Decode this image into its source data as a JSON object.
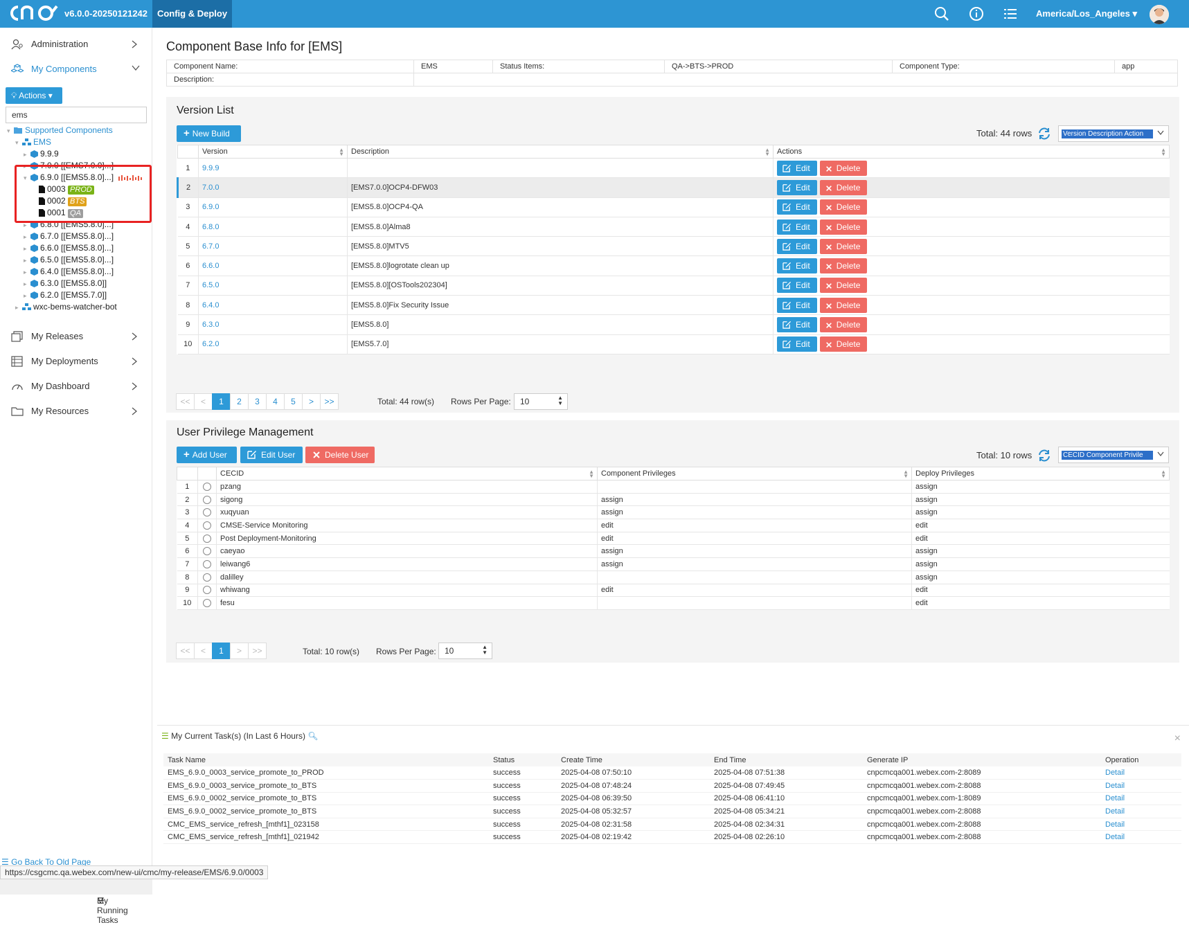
{
  "app": {
    "version": "v6.0.0-20250121242",
    "nav_active": "Config & Deploy",
    "timezone": "America/Los_Angeles"
  },
  "sidebar": {
    "items": [
      {
        "label": "Administration",
        "icon": "admin-icon"
      },
      {
        "label": "My Components",
        "icon": "components-icon"
      },
      {
        "label": "My Releases",
        "icon": "releases-icon"
      },
      {
        "label": "My Deployments",
        "icon": "deployments-icon"
      },
      {
        "label": "My Dashboard",
        "icon": "dashboard-icon"
      },
      {
        "label": "My Resources",
        "icon": "folder-icon"
      }
    ],
    "actions_label": "Actions",
    "search_value": "ems",
    "tree": {
      "root": "Supported Components",
      "ems": "EMS",
      "versions": [
        {
          "label": "9.9.9"
        },
        {
          "label": "7.0.0 [[EMS7.0.0]...]"
        },
        {
          "label": "6.9.0 [[EMS5.8.0]...]"
        },
        {
          "label": "6.8.0 [[EMS5.8.0]...]"
        },
        {
          "label": "6.7.0 [[EMS5.8.0]...]"
        },
        {
          "label": "6.6.0 [[EMS5.8.0]...]"
        },
        {
          "label": "6.5.0 [[EMS5.8.0]...]"
        },
        {
          "label": "6.4.0 [[EMS5.8.0]...]"
        },
        {
          "label": "6.3.0 [[EMS5.8.0]]"
        },
        {
          "label": "6.2.0 [[EMS5.7.0]]"
        }
      ],
      "builds": [
        {
          "id": "0003",
          "badge": "PROD",
          "color": "#7ab317"
        },
        {
          "id": "0002",
          "badge": "BTS",
          "color": "#e0a21a"
        },
        {
          "id": "0001",
          "badge": "QA",
          "color": "#9e9e9e"
        }
      ],
      "other": "wxc-bems-watcher-bot"
    },
    "go_back": "Go Back To Old Page",
    "running_tasks": "My Running Tasks"
  },
  "status_url": "https://csgcmc.qa.webex.com/new-ui/cmc/my-release/EMS/6.9.0/0003",
  "base_info": {
    "title": "Component Base Info for [EMS]",
    "component_name_label": "Component Name:",
    "component_name": "EMS",
    "status_items_label": "Status Items:",
    "status_items": "QA->BTS->PROD",
    "component_type_label": "Component Type:",
    "component_type": "app",
    "description_label": "Description:",
    "description": ""
  },
  "version_list": {
    "title": "Version List",
    "new_build": "New Build",
    "total": "Total: 44 rows",
    "column_selector": "Version Description Action",
    "headers": [
      "Version",
      "Description",
      "Actions"
    ],
    "edit_label": "Edit",
    "delete_label": "Delete",
    "rows": [
      {
        "n": "1",
        "version": "9.9.9",
        "description": ""
      },
      {
        "n": "2",
        "version": "7.0.0",
        "description": "[EMS7.0.0]OCP4-DFW03"
      },
      {
        "n": "3",
        "version": "6.9.0",
        "description": "[EMS5.8.0]OCP4-QA"
      },
      {
        "n": "4",
        "version": "6.8.0",
        "description": "[EMS5.8.0]Alma8"
      },
      {
        "n": "5",
        "version": "6.7.0",
        "description": "[EMS5.8.0]MTV5"
      },
      {
        "n": "6",
        "version": "6.6.0",
        "description": "[EMS5.8.0]logrotate clean up"
      },
      {
        "n": "7",
        "version": "6.5.0",
        "description": "[EMS5.8.0][OSTools202304]"
      },
      {
        "n": "8",
        "version": "6.4.0",
        "description": "[EMS5.8.0]Fix Security Issue"
      },
      {
        "n": "9",
        "version": "6.3.0",
        "description": "[EMS5.8.0]"
      },
      {
        "n": "10",
        "version": "6.2.0",
        "description": "[EMS5.7.0]"
      }
    ],
    "pager": [
      "<<",
      "<",
      "1",
      "2",
      "3",
      "4",
      "5",
      ">",
      ">>"
    ],
    "pager_total": "Total: 44 row(s)",
    "rows_per_page_label": "Rows Per Page:",
    "rows_per_page": "10"
  },
  "user_priv": {
    "title": "User Privilege Management",
    "add_user": "Add User",
    "edit_user": "Edit User",
    "delete_user": "Delete User",
    "total": "Total: 10 rows",
    "column_selector": "CECID Component Privile",
    "headers": [
      "CECID",
      "Component Privileges",
      "Deploy Privileges"
    ],
    "rows": [
      {
        "n": "1",
        "cecid": "pzang",
        "comp": "",
        "deploy": "assign"
      },
      {
        "n": "2",
        "cecid": "sigong",
        "comp": "assign",
        "deploy": "assign"
      },
      {
        "n": "3",
        "cecid": "xuqyuan",
        "comp": "assign",
        "deploy": "assign"
      },
      {
        "n": "4",
        "cecid": "CMSE-Service Monitoring",
        "comp": "edit",
        "deploy": "edit"
      },
      {
        "n": "5",
        "cecid": "Post Deployment-Monitoring",
        "comp": "edit",
        "deploy": "edit"
      },
      {
        "n": "6",
        "cecid": "caeyao",
        "comp": "assign",
        "deploy": "assign"
      },
      {
        "n": "7",
        "cecid": "leiwang6",
        "comp": "assign",
        "deploy": "assign"
      },
      {
        "n": "8",
        "cecid": "dalilley",
        "comp": "",
        "deploy": "assign"
      },
      {
        "n": "9",
        "cecid": "whiwang",
        "comp": "edit",
        "deploy": "edit"
      },
      {
        "n": "10",
        "cecid": "fesu",
        "comp": "",
        "deploy": "edit"
      }
    ],
    "pager": [
      "<<",
      "<",
      "1",
      ">",
      ">>"
    ],
    "pager_total": "Total: 10 row(s)",
    "rows_per_page_label": "Rows Per Page:",
    "rows_per_page": "10"
  },
  "tasks": {
    "title": "My Current Task(s) (In Last 6 Hours)",
    "close": "×",
    "headers": [
      "Task Name",
      "Status",
      "Create Time",
      "End Time",
      "Generate IP",
      "Operation"
    ],
    "rows": [
      {
        "name": "EMS_6.9.0_0003_service_promote_to_PROD",
        "status": "success",
        "create": "2025-04-08 07:50:10",
        "end": "2025-04-08 07:51:38",
        "ip": "cnpcmcqa001.webex.com-2:8089",
        "op": "Detail"
      },
      {
        "name": "EMS_6.9.0_0003_service_promote_to_BTS",
        "status": "success",
        "create": "2025-04-08 07:48:24",
        "end": "2025-04-08 07:49:45",
        "ip": "cnpcmcqa001.webex.com-2:8088",
        "op": "Detail"
      },
      {
        "name": "EMS_6.9.0_0002_service_promote_to_BTS",
        "status": "success",
        "create": "2025-04-08 06:39:50",
        "end": "2025-04-08 06:41:10",
        "ip": "cnpcmcqa001.webex.com-1:8089",
        "op": "Detail"
      },
      {
        "name": "EMS_6.9.0_0002_service_promote_to_BTS",
        "status": "success",
        "create": "2025-04-08 05:32:57",
        "end": "2025-04-08 05:34:21",
        "ip": "cnpcmcqa001.webex.com-2:8088",
        "op": "Detail"
      },
      {
        "name": "CMC_EMS_service_refresh_[mthf1]_023158",
        "status": "success",
        "create": "2025-04-08 02:31:58",
        "end": "2025-04-08 02:34:31",
        "ip": "cnpcmcqa001.webex.com-2:8088",
        "op": "Detail"
      },
      {
        "name": "CMC_EMS_service_refresh_[mthf1]_021942",
        "status": "success",
        "create": "2025-04-08 02:19:42",
        "end": "2025-04-08 02:26:10",
        "ip": "cnpcmcqa001.webex.com-2:8088",
        "op": "Detail"
      }
    ]
  }
}
